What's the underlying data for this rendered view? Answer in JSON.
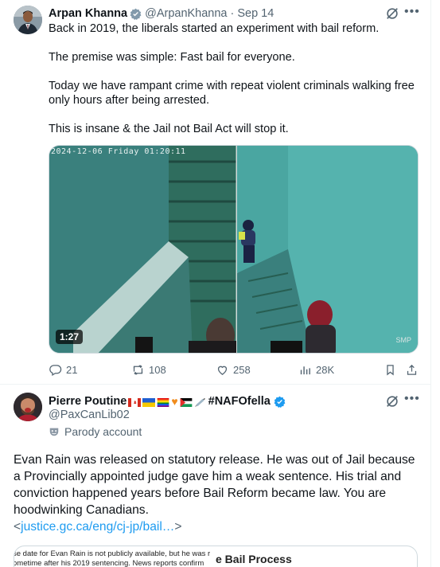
{
  "tweet1": {
    "author_name": "Arpan Khanna",
    "handle": "@ArpanKhanna",
    "separator": "·",
    "time": "Sep 14",
    "paragraphs": [
      "Back in 2019, the liberals started an experiment with bail reform.",
      "The premise was simple: Fast bail for everyone.",
      "Today we have rampant crime with repeat violent criminals walking free only hours after being arrested.",
      "This is insane & the Jail not Bail Act will stop it."
    ],
    "video": {
      "timestamp": "2024-12-06 Friday 01:20:11",
      "duration": "1:27",
      "watermark": "SMP"
    },
    "actions": {
      "replies": "21",
      "reposts": "108",
      "likes": "258",
      "views": "28K"
    }
  },
  "tweet2": {
    "author_name": "Pierre Poutine",
    "name_suffix": "#NAFOfella",
    "handle": "@PaxCanLib02",
    "account_label": "Parody account",
    "body": "Evan Rain was released on statutory release. He was out of Jail because a Provincially appointed judge gave him a weak sentence. His trial and conviction happened years before Bail Reform became law. You are hoodwinking Canadians.",
    "link_prefix": "<",
    "link_text": "justice.gc.ca/eng/cj-jp/bail…",
    "link_suffix": ">",
    "card": {
      "left_line1": "se date for Evan Rain is not publicly available, but he was r",
      "left_line2": "ometime after his 2019 sentencing. News reports confirm",
      "right_title": "e Bail Process"
    }
  },
  "colors": {
    "text_primary": "#0f1419",
    "text_secondary": "#536471",
    "accent_blue": "#1d9bf0",
    "border": "#cfd9de"
  },
  "icons": [
    "verified-badge-icon",
    "grok-icon",
    "more-icon",
    "reply-icon",
    "repost-icon",
    "like-icon",
    "views-icon",
    "bookmark-icon",
    "share-icon",
    "parody-mask-icon"
  ]
}
